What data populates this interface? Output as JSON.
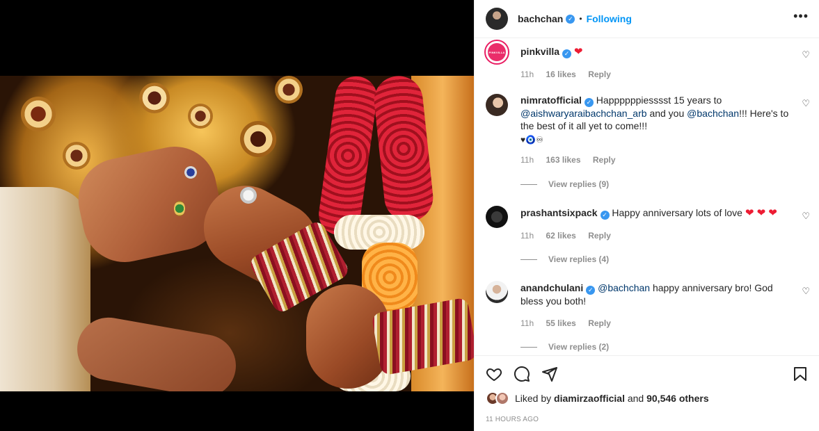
{
  "post": {
    "username": "bachchan",
    "follow_state": "Following",
    "more_icon": "more-options-icon"
  },
  "comments": [
    {
      "username": "pinkvilla",
      "avatar_text": "PINKVILLA",
      "text": "",
      "emoji": "❤",
      "time": "11h",
      "likes": "16 likes",
      "reply": "Reply"
    },
    {
      "username": "nimratofficial",
      "text_parts": [
        "Happppppiesssst 15 years to",
        "@aishwaryaraibachchan_arb",
        "and you",
        "@bachchan",
        "!!! Here's to the best of it all yet to come!!!"
      ],
      "emoji_line": "♥🧿♾",
      "time": "11h",
      "likes": "163 likes",
      "reply": "Reply",
      "view_replies": "View replies (9)"
    },
    {
      "username": "prashantsixpack",
      "text": "Happy anniversary lots of love",
      "emoji": "❤ ❤ ❤",
      "time": "11h",
      "likes": "62 likes",
      "reply": "Reply",
      "view_replies": "View replies (4)"
    },
    {
      "username": "anandchulani",
      "mention": "@bachchan",
      "text": "happy anniversary bro! God bless you both!",
      "time": "11h",
      "likes": "55 likes",
      "reply": "Reply",
      "view_replies": "View replies (2)"
    }
  ],
  "actions": {
    "icons": [
      "heart-icon",
      "comment-icon",
      "share-icon",
      "bookmark-icon"
    ]
  },
  "likes": {
    "prefix": "Liked by",
    "user": "diamirzaofficial",
    "and": "and",
    "count": "90,546 others"
  },
  "timestamp": "11 HOURS AGO",
  "colors": {
    "accent": "#0095f6",
    "verified": "#3897f0",
    "heart": "#ed1c33",
    "muted": "#8e8e8e"
  }
}
